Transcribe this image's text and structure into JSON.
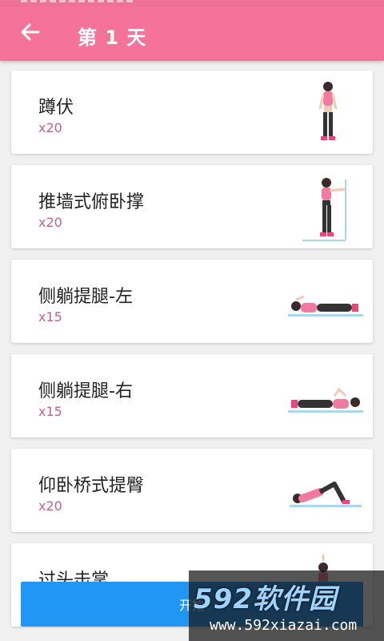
{
  "header": {
    "title": "第 1 天",
    "back_icon": "arrow-left-icon",
    "bar_color": "#f5739b"
  },
  "exercises": [
    {
      "name": "蹲伏",
      "reps": "x20",
      "figure": "woman-standing-figure"
    },
    {
      "name": "推墙式俯卧撑",
      "reps": "x20",
      "figure": "woman-wall-pushup-figure"
    },
    {
      "name": "侧躺提腿-左",
      "reps": "x15",
      "figure": "woman-side-lying-figure"
    },
    {
      "name": "侧躺提腿-右",
      "reps": "x15",
      "figure": "woman-side-lying-figure"
    },
    {
      "name": "仰卧桥式提臀",
      "reps": "x20",
      "figure": "woman-glute-bridge-figure"
    },
    {
      "name": "过头击掌",
      "reps": "",
      "figure": "woman-overhead-clap-figure"
    }
  ],
  "footer": {
    "start_label": "开始",
    "button_color": "#2196f3"
  },
  "watermark": {
    "logo": "592软件园",
    "url": "www.592xiazai.com"
  }
}
